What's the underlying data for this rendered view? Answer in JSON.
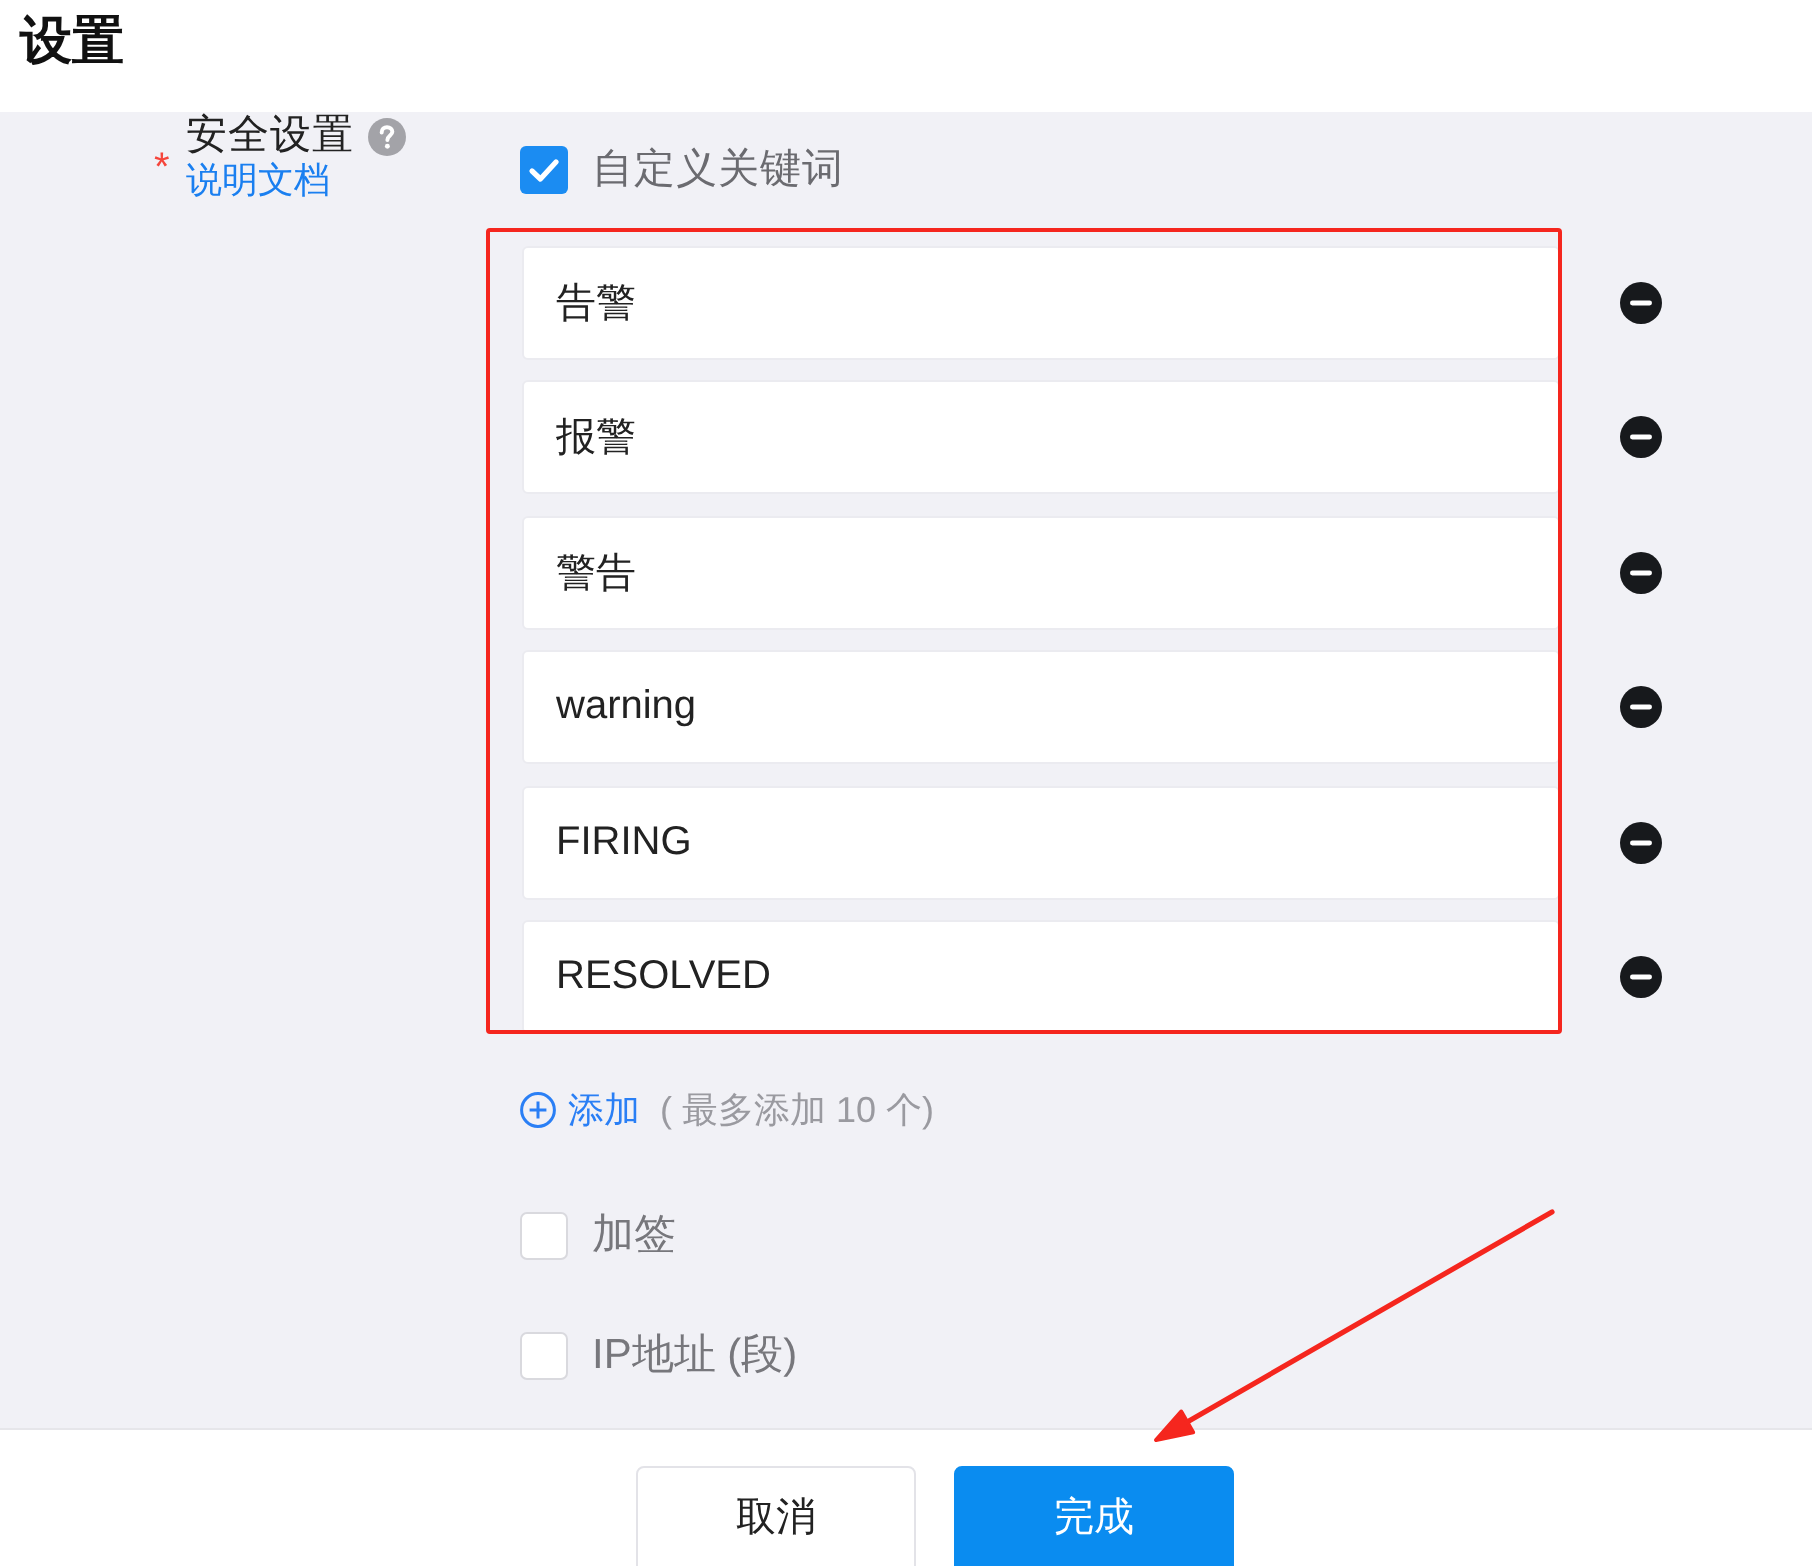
{
  "page": {
    "title": "设置"
  },
  "security": {
    "required_mark": "*",
    "label": "安全设置",
    "help_link": "说明文档"
  },
  "custom_keywords": {
    "label": "自定义关键词",
    "checked": true
  },
  "keywords": [
    {
      "value": "告警"
    },
    {
      "value": "报警"
    },
    {
      "value": "警告"
    },
    {
      "value": "warning"
    },
    {
      "value": "FIRING"
    },
    {
      "value": "RESOLVED"
    }
  ],
  "add": {
    "label": "添加",
    "hint": "( 最多添加 10 个)"
  },
  "options": [
    {
      "label": "加签",
      "checked": false
    },
    {
      "label": "IP地址 (段)",
      "checked": false
    }
  ],
  "buttons": [
    {
      "label": "取消",
      "kind": "secondary"
    },
    {
      "label": "完成",
      "kind": "primary"
    }
  ],
  "annotations": {
    "highlight_box": true,
    "arrow": true
  }
}
